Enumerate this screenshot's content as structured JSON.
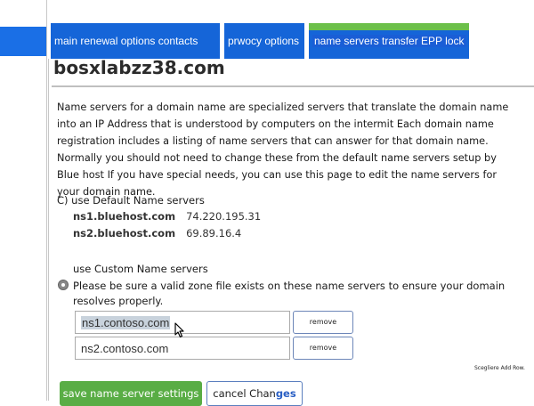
{
  "tabs": [
    {
      "label": "main renewal options contacts"
    },
    {
      "label": "prwocy options"
    },
    {
      "label": "name servers transfer EPP lock"
    }
  ],
  "domain_name": "bosxlabzz38.com",
  "description": "Name servers for a domain name are specialized servers that translate the domain name into an IP Address that is understood by computers on the intermit Each domain name registration includes a listing of name servers that can answer for that domain name. Normally you should not need to change these from the default name servers setup by Blue host If you have special needs, you can use this page to edit the name servers for your domain name.",
  "default_option": {
    "label": "C) use Default Name servers",
    "servers": [
      {
        "host": "ns1.bluehost.com",
        "ip": "74.220.195.31"
      },
      {
        "host": "ns2.bluehost.com",
        "ip": "69.89.16.4"
      }
    ]
  },
  "custom_option": {
    "label": "use Custom Name servers",
    "warning": "Please be sure a valid zone file exists on these name servers to ensure your domain resolves properly.",
    "fields": [
      {
        "value": "ns1.contoso.com",
        "remove_label": "remove"
      },
      {
        "value": "ns2.contoso.com",
        "remove_label": "remove"
      }
    ],
    "add_row_label": "Scegliere Add Row."
  },
  "buttons": {
    "save": "save name server settings",
    "cancel_prefix": "cancel Chan",
    "cancel_suffix": "ges"
  },
  "colors": {
    "tab_blue": "#1565d8",
    "active_tab_green": "#6cc04a",
    "save_green": "#59ad45"
  }
}
